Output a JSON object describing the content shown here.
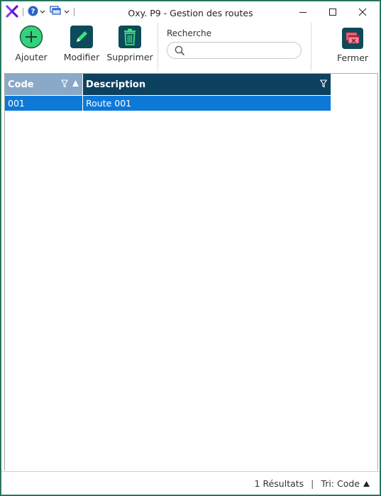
{
  "window": {
    "title": "Oxy. P9 - Gestion des routes"
  },
  "toolbar": {
    "add_label": "Ajouter",
    "edit_label": "Modifier",
    "delete_label": "Supprimer",
    "close_label": "Fermer"
  },
  "search": {
    "label": "Recherche",
    "value": "",
    "placeholder": ""
  },
  "grid": {
    "columns": [
      {
        "label": "Code"
      },
      {
        "label": "Description"
      }
    ],
    "rows": [
      {
        "code": "001",
        "description": "Route 001"
      }
    ]
  },
  "status": {
    "results": "1 Résultats",
    "separator": "|",
    "sort": "Tri: Code"
  },
  "colors": {
    "header_code": "#8aa8c7",
    "header_desc": "#0d4160",
    "selected_row": "#0c79d8",
    "add_green": "#2ecc71",
    "brand_purple": "#7b2ff7"
  },
  "icons": {
    "logo": "oxy-logo-icon",
    "help": "help-icon",
    "windows": "window-stack-icon",
    "add": "plus-circle-icon",
    "edit": "pencil-icon",
    "delete": "trash-icon",
    "search": "search-icon",
    "close": "close-window-icon",
    "filter": "filter-icon",
    "sort": "sort-ascending-icon"
  }
}
